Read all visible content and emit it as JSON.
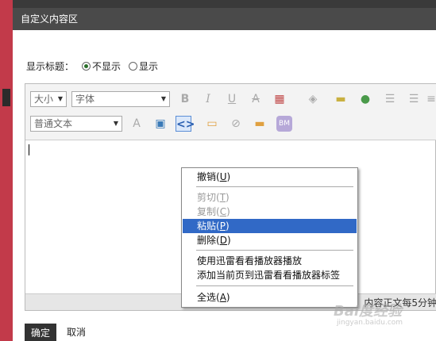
{
  "dialog": {
    "title": "自定义内容区"
  },
  "show_title": {
    "label": "显示标题：",
    "options": [
      {
        "label": "不显示",
        "selected": true
      },
      {
        "label": "显示",
        "selected": false
      }
    ]
  },
  "toolbar": {
    "size_select": "大小",
    "font_select": "字体",
    "format_select": "普通文本",
    "icons": [
      "bold-icon",
      "italic-icon",
      "underline-icon",
      "strikethrough-icon",
      "table-icon",
      "fill-color-icon",
      "image-icon",
      "emoticon-icon",
      "bullet-list-icon",
      "numbered-list-icon",
      "align-icon",
      "clear-format-icon",
      "media-icon",
      "source-code-icon",
      "insert-icon",
      "link-icon",
      "divider-icon",
      "bm-icon"
    ],
    "bm_label": "BM"
  },
  "status_text": "内容正文每5分钟",
  "buttons": {
    "ok": "确定",
    "cancel": "取消"
  },
  "context_menu": {
    "undo": "撤销",
    "undo_key": "U",
    "cut": "剪切",
    "cut_key": "T",
    "copy": "复制",
    "copy_key": "C",
    "paste": "粘贴",
    "paste_key": "P",
    "delete": "删除",
    "delete_key": "D",
    "play_xunlei": "使用迅雷看看播放器播放",
    "bookmark_xunlei": "添加当前页到迅雷看看播放器标签",
    "select_all": "全选",
    "select_all_key": "A"
  },
  "watermark": {
    "text": "Bai度经验",
    "url": "jingyan.baidu.com"
  },
  "colors": {
    "highlight": "#3169c6",
    "title_bar": "#4a4a4a",
    "ok_button": "#333333"
  }
}
